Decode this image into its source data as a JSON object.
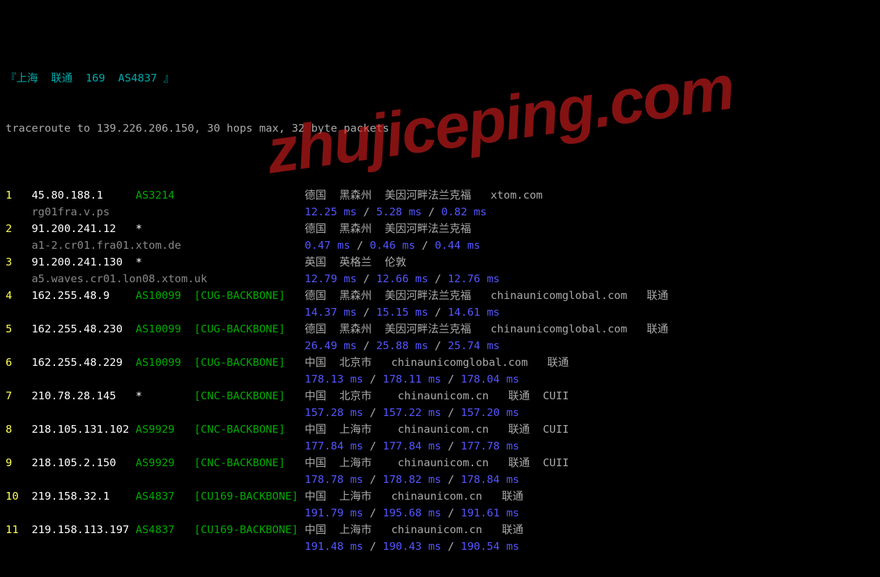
{
  "header_line": "『上海  联通  169  AS4837 』",
  "cmd_line": "traceroute to 139.226.206.150, 30 hops max, 32 byte packets",
  "watermark_text": "zhujiceping.com",
  "hops": [
    {
      "num": "1",
      "ip": "45.80.188.1",
      "asn": "AS3214",
      "asn_star": false,
      "tag": "",
      "loc": "德国  黑森州  美因河畔法兰克福   xtom.com",
      "rdns": "rg01fra.v.ps",
      "t1": "12.25 ms",
      "t2": "5.28 ms",
      "t3": "0.82 ms"
    },
    {
      "num": "2",
      "ip": "91.200.241.12",
      "asn": "*",
      "asn_star": true,
      "tag": "",
      "loc": "德国  黑森州  美因河畔法兰克福",
      "rdns": "a1-2.cr01.fra01.xtom.de",
      "t1": "0.47 ms",
      "t2": "0.46 ms",
      "t3": "0.44 ms"
    },
    {
      "num": "3",
      "ip": "91.200.241.130",
      "asn": "*",
      "asn_star": true,
      "tag": "",
      "loc": "英国  英格兰  伦敦",
      "rdns": "a5.waves.cr01.lon08.xtom.uk",
      "t1": "12.79 ms",
      "t2": "12.66 ms",
      "t3": "12.76 ms"
    },
    {
      "num": "4",
      "ip": "162.255.48.9",
      "asn": "AS10099",
      "asn_star": false,
      "tag": "[CUG-BACKBONE]",
      "loc": "德国  黑森州  美因河畔法兰克福   chinaunicomglobal.com   联通",
      "rdns": "",
      "t1": "14.37 ms",
      "t2": "15.15 ms",
      "t3": "14.61 ms"
    },
    {
      "num": "5",
      "ip": "162.255.48.230",
      "asn": "AS10099",
      "asn_star": false,
      "tag": "[CUG-BACKBONE]",
      "loc": "德国  黑森州  美因河畔法兰克福   chinaunicomglobal.com   联通",
      "rdns": "",
      "t1": "26.49 ms",
      "t2": "25.88 ms",
      "t3": "25.74 ms"
    },
    {
      "num": "6",
      "ip": "162.255.48.229",
      "asn": "AS10099",
      "asn_star": false,
      "tag": "[CUG-BACKBONE]",
      "loc": "中国  北京市   chinaunicomglobal.com   联通",
      "rdns": "",
      "t1": "178.13 ms",
      "t2": "178.11 ms",
      "t3": "178.04 ms"
    },
    {
      "num": "7",
      "ip": "210.78.28.145",
      "asn": "*",
      "asn_star": true,
      "tag": "[CNC-BACKBONE]",
      "loc": "中国  北京市    chinaunicom.cn   联通  CUII",
      "rdns": "",
      "t1": "157.28 ms",
      "t2": "157.22 ms",
      "t3": "157.20 ms"
    },
    {
      "num": "8",
      "ip": "218.105.131.102",
      "asn": "AS9929",
      "asn_star": false,
      "tag": "[CNC-BACKBONE]",
      "loc": "中国  上海市    chinaunicom.cn   联通  CUII",
      "rdns": "",
      "t1": "177.84 ms",
      "t2": "177.84 ms",
      "t3": "177.78 ms"
    },
    {
      "num": "9",
      "ip": "218.105.2.150",
      "asn": "AS9929",
      "asn_star": false,
      "tag": "[CNC-BACKBONE]",
      "loc": "中国  上海市    chinaunicom.cn   联通  CUII",
      "rdns": "",
      "t1": "178.78 ms",
      "t2": "178.82 ms",
      "t3": "178.84 ms"
    },
    {
      "num": "10",
      "ip": "219.158.32.1",
      "asn": "AS4837",
      "asn_star": false,
      "tag": "[CU169-BACKBONE]",
      "loc": "中国  上海市   chinaunicom.cn   联通",
      "rdns": "",
      "t1": "191.79 ms",
      "t2": "195.68 ms",
      "t3": "191.61 ms"
    },
    {
      "num": "11",
      "ip": "219.158.113.197",
      "asn": "AS4837",
      "asn_star": false,
      "tag": "[CU169-BACKBONE]",
      "loc": "中国  上海市   chinaunicom.cn   联通",
      "rdns": "",
      "t1": "191.48 ms",
      "t2": "190.43 ms",
      "t3": "190.54 ms"
    }
  ]
}
